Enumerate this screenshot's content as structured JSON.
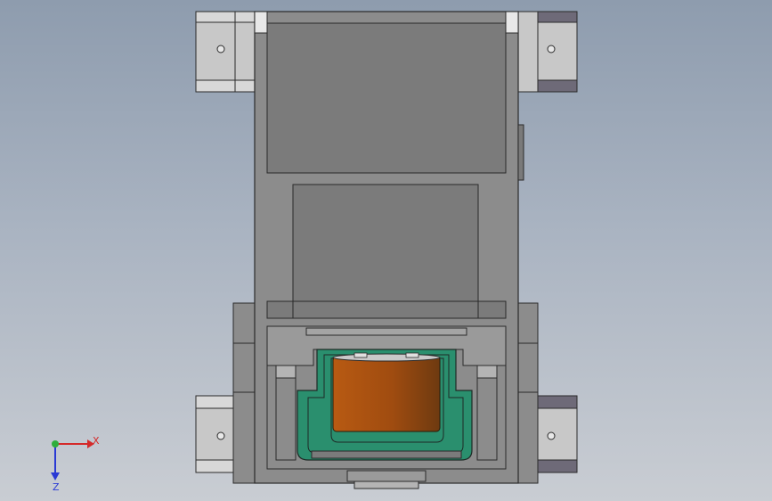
{
  "view": {
    "background_top": "#8e9cae",
    "background_bottom": "#c9cdd3",
    "part_colors": {
      "frame": "#8c8c8c",
      "panel": "#7b7b7b",
      "bracket": "#c8c8c8",
      "bracket_dark": "#6e6a78",
      "coil": "#b85a12",
      "coil_dark": "#6e3a10",
      "holder": "#2a8f6e",
      "outline": "#2a2a2a"
    }
  },
  "triad": {
    "x_label": "X",
    "z_label": "Z",
    "x_color": "#d42a2a",
    "y_color": "#2fae3c",
    "z_color": "#2a3ad4"
  }
}
